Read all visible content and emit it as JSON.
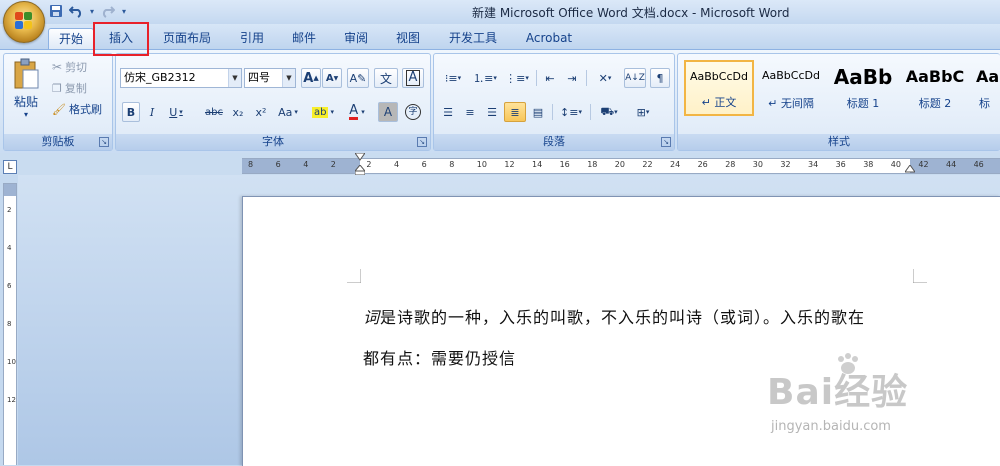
{
  "window": {
    "title": "新建 Microsoft Office Word 文档.docx - Microsoft Word"
  },
  "qat": {
    "save_icon": "save-icon",
    "undo_icon": "undo-icon",
    "redo_icon": "redo-icon"
  },
  "tabs": [
    {
      "label": "开始"
    },
    {
      "label": "插入"
    },
    {
      "label": "页面布局"
    },
    {
      "label": "引用"
    },
    {
      "label": "邮件"
    },
    {
      "label": "审阅"
    },
    {
      "label": "视图"
    },
    {
      "label": "开发工具"
    },
    {
      "label": "Acrobat"
    }
  ],
  "clipboard": {
    "label": "剪贴板",
    "paste": "粘贴",
    "cut": "剪切",
    "copy": "复制",
    "format_painter": "格式刷"
  },
  "font": {
    "label": "字体",
    "name": "仿宋_GB2312",
    "size": "四号",
    "bold": "B",
    "italic": "I",
    "underline": "U",
    "strike": "abc",
    "subscript": "x₂",
    "superscript": "x²",
    "change_case": "Aa",
    "grow": "A",
    "shrink": "A",
    "char_border": "A",
    "phonetic": "文",
    "char_shading": "A",
    "enclose": "字"
  },
  "paragraph": {
    "label": "段落"
  },
  "styles": {
    "label": "样式",
    "items": [
      {
        "sample": "AaBbCcDd",
        "name": "↵ 正文"
      },
      {
        "sample": "AaBbCcDd",
        "name": "↵ 无间隔"
      },
      {
        "sample": "AaBb",
        "name": "标题 1"
      },
      {
        "sample": "AaBbC",
        "name": "标题 2"
      },
      {
        "sample": "Aa",
        "name": "标"
      }
    ]
  },
  "ruler": {
    "tab_selector": "L",
    "numbers": [
      "8",
      "6",
      "4",
      "2",
      "2",
      "4",
      "6",
      "8",
      "10",
      "12",
      "14",
      "16",
      "18",
      "20",
      "22",
      "24",
      "26",
      "28",
      "30",
      "32",
      "34",
      "36",
      "38",
      "40",
      "42",
      "44",
      "46"
    ],
    "vertical_numbers": [
      "2",
      "4",
      "6",
      "8",
      "10",
      "12"
    ]
  },
  "document": {
    "line1_italic": "词",
    "line1_rest": "是诗歌的一种，入乐的叫歌，不入乐的叫诗（或词）。入乐的歌在",
    "line2": "都有点：需要仍授信"
  },
  "watermark": {
    "big": "Bai经验",
    "small": "jingyan.baidu.com"
  },
  "colors": {
    "highlight_border": "#e8212a",
    "ribbon_bg": "#dde9f7",
    "accent": "#15428b"
  }
}
